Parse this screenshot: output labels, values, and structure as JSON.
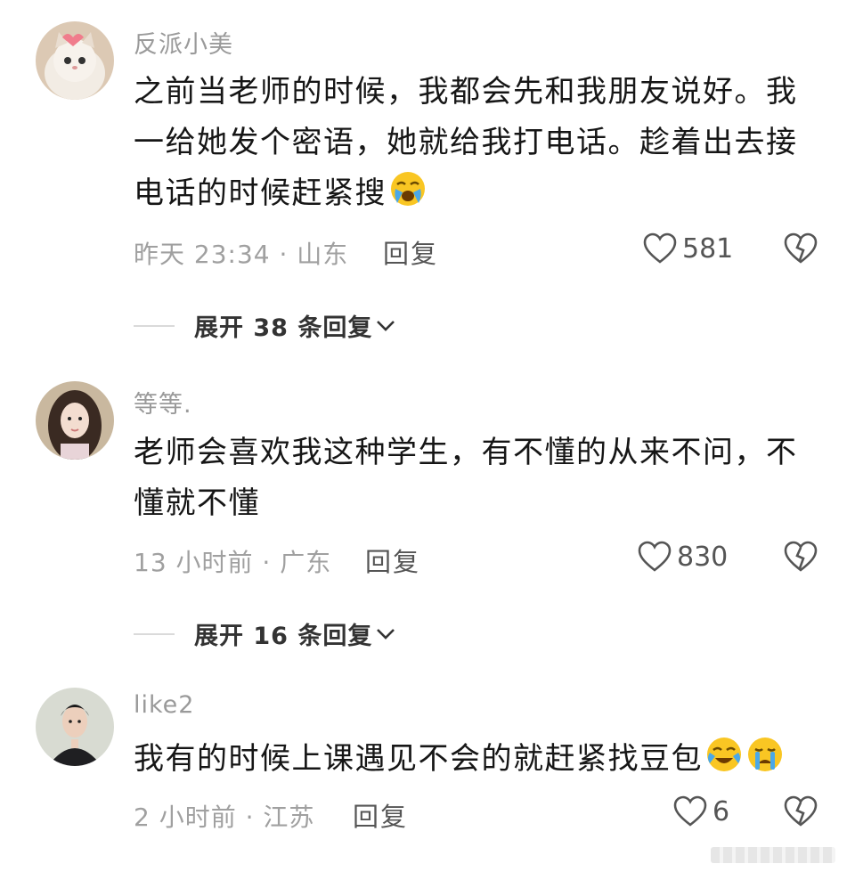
{
  "comments": [
    {
      "username": "反派小美",
      "text": "之前当老师的时候，我都会先和我朋友说好。我一给她发个密语，她就给我打电话。趁着出去接电话的时候赶紧搜",
      "meta": "昨天 23:34 · 山东",
      "reply_label": "回复",
      "likes": "581",
      "expand_label": "展开 38 条回复",
      "emojis": [
        "cry-face-emoji"
      ]
    },
    {
      "username": "等等.",
      "text": "老师会喜欢我这种学生，有不懂的从来不问，不懂就不懂",
      "meta": "13 小时前 · 广东",
      "reply_label": "回复",
      "likes": "830",
      "expand_label": "展开 16 条回复",
      "emojis": []
    },
    {
      "username": "like2",
      "text": "我有的时候上课遇见不会的就赶紧找豆包",
      "meta": "2 小时前 · 江苏",
      "reply_label": "回复",
      "likes": "6",
      "emojis": [
        "cry-laugh-emoji",
        "crying-emoji"
      ]
    }
  ],
  "icons": {
    "like": "heart-outline-icon",
    "dislike": "broken-heart-icon",
    "expand": "chevron-down-icon"
  },
  "colors": {
    "username": "#9a9a9a",
    "text": "#161616",
    "meta": "#a0a0a0",
    "background": "#ffffff"
  }
}
